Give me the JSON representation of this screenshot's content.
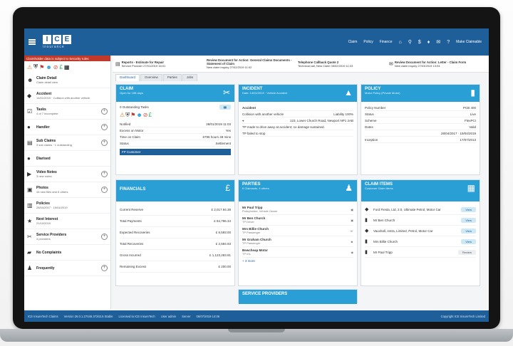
{
  "app": {
    "logo_letters": [
      "I",
      "C",
      "E"
    ],
    "logo_subtitle": "insurance"
  },
  "topnav": {
    "items": [
      "Claim",
      "Policy",
      "Finance"
    ],
    "user": "Make Claimable"
  },
  "sidebar": {
    "notice": "Claimholder data is subject to Security rules",
    "items": [
      {
        "title": "Claim Detail",
        "sub": "Claim detail view",
        "icon": "person-icon",
        "plus": false
      },
      {
        "title": "Accident",
        "sub": "14/01/2019 · Collision with another vehicle",
        "icon": "car-icon",
        "plus": false
      },
      {
        "title": "Tasks",
        "sub": "4 of 7 incomplete",
        "icon": "checklist-icon",
        "plus": true
      },
      {
        "title": "Handler",
        "sub": "",
        "icon": "user-icon",
        "plus": true
      },
      {
        "title": "Sub Claims",
        "sub": "3 sub claims · 1 outstanding",
        "icon": "folder-icon",
        "plus": true
      },
      {
        "title": "Diarised",
        "sub": "",
        "icon": "calendar-icon",
        "plus": false
      },
      {
        "title": "Video Notes",
        "sub": "3 new notes",
        "icon": "video-icon",
        "plus": true
      },
      {
        "title": "Photos",
        "sub": "44 new files and 6 others",
        "icon": "camera-icon",
        "plus": true
      },
      {
        "title": "Policies",
        "sub": "28/04/2017 · 19/04/2019",
        "icon": "document-icon",
        "plus": false
      },
      {
        "title": "Next Interest",
        "sub": "21/10/2019",
        "icon": "star-icon",
        "plus": false
      },
      {
        "title": "Service Providers",
        "sub": "3 providers",
        "icon": "wrench-icon",
        "plus": true
      },
      {
        "title": "No Complaints",
        "sub": "",
        "icon": "speech-icon",
        "plus": false
      },
      {
        "title": "Frequently",
        "sub": "",
        "icon": "people-icon",
        "plus": true
      }
    ]
  },
  "docs": [
    {
      "title": "Reports - Estimate for Repair",
      "sub": "Service Provider",
      "date": "27/01/2019 16:01"
    },
    {
      "title": "Review Document for Action: General Claims Documents - Statement of Claim",
      "sub": "New claim inquiry",
      "date": "27/02/2019 11:02"
    },
    {
      "title": "Telephone Callback Quote 2",
      "sub": "Technical call, New Claim",
      "date": "05/02/2019 11:03"
    },
    {
      "title": "Review Document for Action: Letter - Claim Form",
      "sub": "New claim inquiry",
      "date": "27/03/2019 13:04"
    }
  ],
  "tabs": [
    "Dashboard",
    "Overview",
    "Parties",
    "Jobs"
  ],
  "cards": {
    "claim": {
      "title": "CLAIM",
      "sub": "Open for 188 days",
      "line": "0 Outstanding Tasks",
      "rows": [
        {
          "k": "Notified",
          "v": "28/01/2019 11:03"
        },
        {
          "k": "Excess on Motor",
          "v": "Yes"
        },
        {
          "k": "Time on Claim",
          "v": "6795 hours 48 mins"
        },
        {
          "k": "Status",
          "v": "Settlement"
        }
      ],
      "button": "FP Customer"
    },
    "incident": {
      "title": "INCIDENT",
      "sub": "Date: 14/01/2019 · Vehicle Accident",
      "rows": [
        {
          "k": "Accident",
          "v": ""
        },
        {
          "k": "Collision with another vehicle",
          "v": "Liability 100%"
        },
        {
          "k": "123, Lower Church Road, Newport NP1 2AB",
          "v": ""
        },
        {
          "k": "TP made to drive away at accident; no damage sustained.",
          "v": ""
        },
        {
          "k": "TP failed to stop",
          "v": ""
        }
      ]
    },
    "policy": {
      "title": "POLICY",
      "sub": "Motor Policy (Private Motor)",
      "rows": [
        {
          "k": "Policy Number",
          "v": "PCB 400"
        },
        {
          "k": "Status",
          "v": "Live"
        },
        {
          "k": "Scheme",
          "v": "FlexPCI"
        },
        {
          "k": "Dates",
          "v": "Valid"
        },
        {
          "k": "",
          "v": "28/04/2017 · 19/04/2019"
        },
        {
          "k": "Inception",
          "v": "17/07/2013"
        }
      ]
    },
    "financials": {
      "title": "FINANCIALS",
      "rows": [
        {
          "k": "Current Reserve",
          "v": "£ 2,017.94.38"
        },
        {
          "k": "Total Payments",
          "v": "£ 84,796.34"
        },
        {
          "k": "Expected Recoveries",
          "v": "£ 6,593.00"
        },
        {
          "k": "Total Recoveries",
          "v": "£ 2,584.93"
        },
        {
          "k": "Gross Incurred",
          "v": "£ 1,123,283.91"
        },
        {
          "k": "Remaining Excess",
          "v": "£ 200.00"
        }
      ]
    },
    "parties": {
      "title": "PARTIES",
      "sub": "6 Claimants, 4 others",
      "rows": [
        {
          "name": "Mr Paul Tripp",
          "role": "Policyholder, Vehicle Owner"
        },
        {
          "name": "Mr Ben Church",
          "role": "TP Driver"
        },
        {
          "name": "Mrs Billie Church",
          "role": "TP Passenger"
        },
        {
          "name": "Mr Graham Church",
          "role": "TP Passenger"
        },
        {
          "name": "Bewcheap Motor",
          "role": "TP Ins"
        }
      ],
      "more": "+ 3 more"
    },
    "claim_items": {
      "title": "CLAIM ITEMS",
      "sub": "Customer Claim Items",
      "rows": [
        {
          "text": "Ford Fiesta, Ltd, 2.0, Ultimate Petrol, Motor Car",
          "pill": "View",
          "icon": "car-icon"
        },
        {
          "text": "Mr Ben Church",
          "pill": "View",
          "icon": "person-icon"
        },
        {
          "text": "Vauxhall, Astra, Limited, Petrol, Motor Car",
          "pill": "View",
          "icon": "car-icon"
        },
        {
          "text": "Mrs Billie Church",
          "pill": "View",
          "icon": "person-icon"
        },
        {
          "text": "Mr Paul Tripp",
          "pill": "Review",
          "icon": "person-icon"
        }
      ]
    },
    "service_providers": {
      "title": "SERVICE PROVIDERS"
    }
  },
  "footer": {
    "left": "ICE InsureTech Claims",
    "version": "Version 26.0.1.27048.37263.5 Stable",
    "licensed": "Licensed to ICE InsureTech",
    "user": "User admin",
    "server": "Server",
    "date": "06/07/2019 14:06",
    "right": "Copyright ICE InsureTech Limited"
  }
}
